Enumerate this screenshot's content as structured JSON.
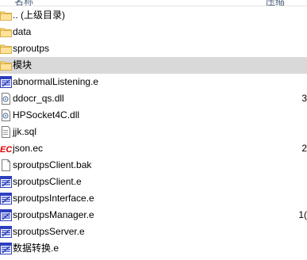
{
  "header": {
    "name_col": "名称",
    "size_col": "压缩"
  },
  "items": [
    {
      "name": ".. (上级目录)",
      "icon": "folder-icon",
      "size": ""
    },
    {
      "name": "data",
      "icon": "folder-icon",
      "size": ""
    },
    {
      "name": "sproutps",
      "icon": "folder-icon",
      "size": ""
    },
    {
      "name": "模块",
      "icon": "folder-icon",
      "size": "",
      "selected": true
    },
    {
      "name": "abnormalListening.e",
      "icon": "e-source-file-icon",
      "size": ""
    },
    {
      "name": "ddocr_qs.dll",
      "icon": "dll-file-icon",
      "size": "3"
    },
    {
      "name": "HPSocket4C.dll",
      "icon": "dll-file-icon",
      "size": ""
    },
    {
      "name": "jjk.sql",
      "icon": "sql-file-icon",
      "size": ""
    },
    {
      "name": "json.ec",
      "icon": "ec-module-icon",
      "size": "2"
    },
    {
      "name": "sproutpsClient.bak",
      "icon": "blank-file-icon",
      "size": ""
    },
    {
      "name": "sproutpsClient.e",
      "icon": "e-source-file-icon",
      "size": ""
    },
    {
      "name": "sproutpsInterface.e",
      "icon": "e-source-file-icon",
      "size": ""
    },
    {
      "name": "sproutpsManager.e",
      "icon": "e-source-file-icon",
      "size": "1("
    },
    {
      "name": "sproutpsServer.e",
      "icon": "e-source-file-icon",
      "size": ""
    },
    {
      "name": "数据转换.e",
      "icon": "e-source-file-icon",
      "size": ""
    }
  ],
  "colors": {
    "folder": "#f8d775",
    "selected_row": "#d9d9d9",
    "e_file": "#2b3fbf",
    "ec_red": "#e00000"
  }
}
